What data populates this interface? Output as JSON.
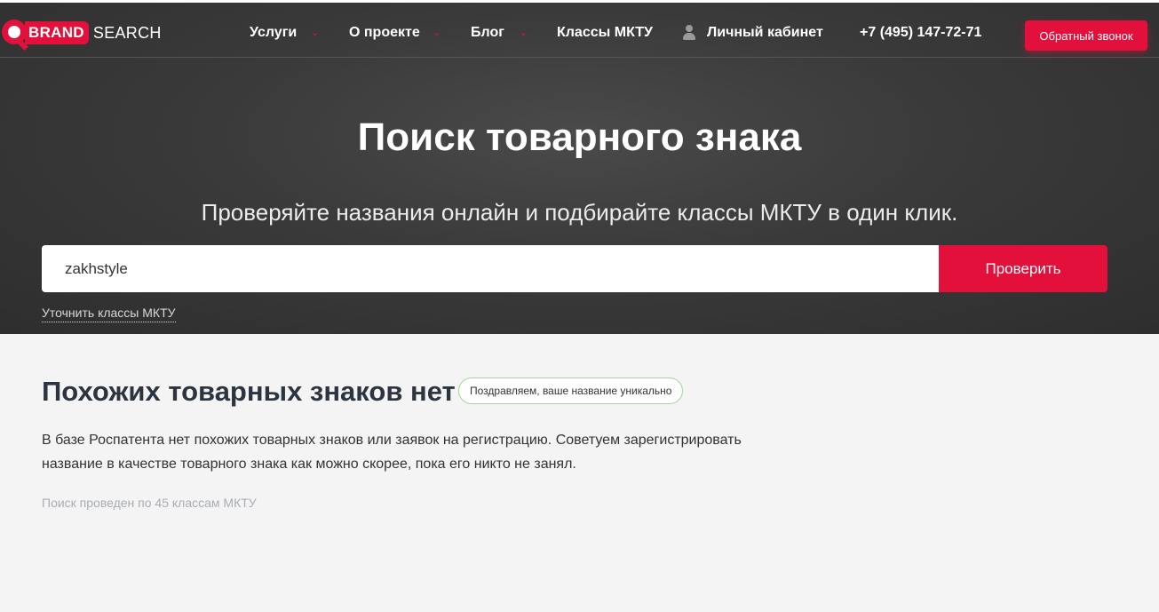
{
  "logo": {
    "brand": "BRAND",
    "search": "SEARCH"
  },
  "nav": {
    "items": [
      {
        "label": "Услуги"
      },
      {
        "label": "О проекте"
      },
      {
        "label": "Блог"
      },
      {
        "label": "Классы МКТУ"
      },
      {
        "label": "Личный кабинет"
      }
    ],
    "phone": "+7 (495) 147-72-71",
    "callback_label": "Обратный звонок"
  },
  "hero": {
    "title": "Поиск товарного знака",
    "subtitle": "Проверяйте названия онлайн и подбирайте классы МКТУ в один клик.",
    "search_value": "zakhstyle",
    "submit_label": "Проверить",
    "refine_link": "Уточнить классы МКТУ"
  },
  "result": {
    "title": "Похожих товарных знаков нет",
    "badge": "Поздравляем, ваше название уникально",
    "text": "В базе Роспатента нет похожих товарных знаков или заявок на регистрацию. Советуем зарегистрировать название в качестве товарного знака как можно скорее, пока его никто не занял.",
    "note": "Поиск проведен по 45 классам МКТУ"
  },
  "colors": {
    "accent": "#e4103c",
    "badge_border": "#9ed99b",
    "hero_bg": "#3a3a3a",
    "page_bg": "#f4f4f4"
  },
  "icons": {
    "logo": "magnifier-logo-icon",
    "chevron": "chevron-down-icon",
    "user": "user-icon"
  }
}
